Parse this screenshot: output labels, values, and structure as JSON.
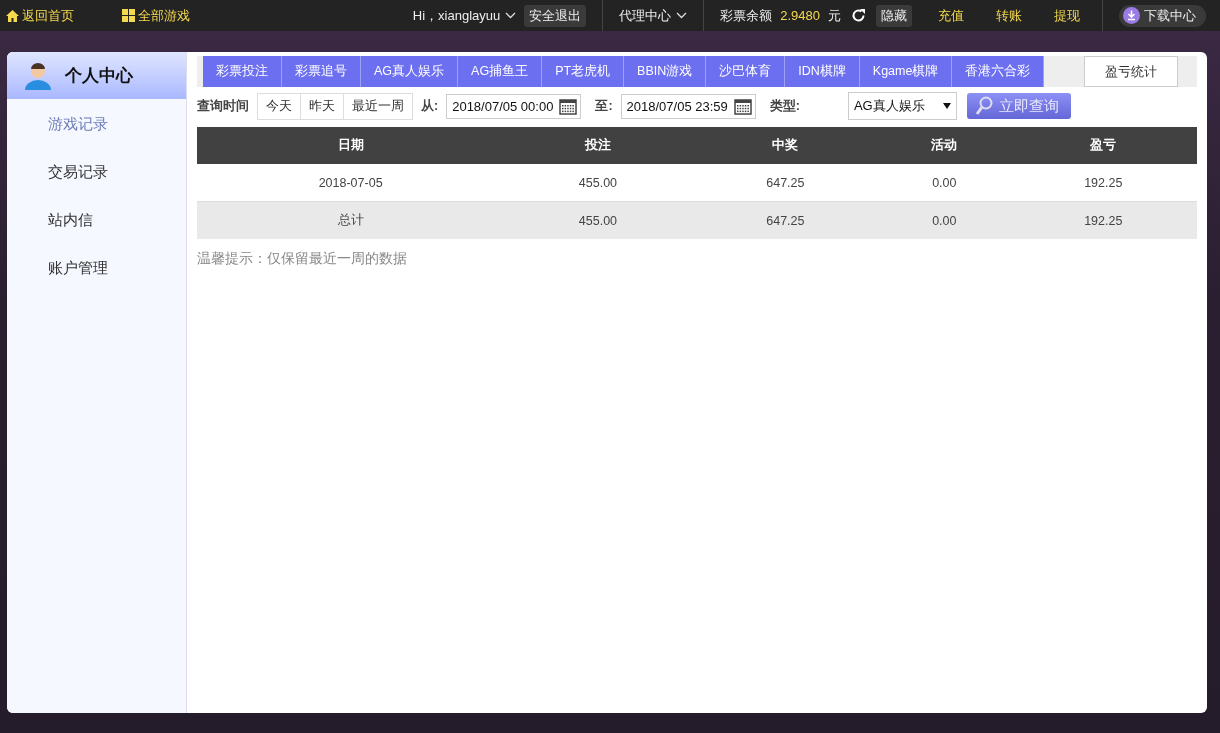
{
  "topbar": {
    "home": "返回首页",
    "all_games": "全部游戏",
    "greeting": "Hi，xianglayuu",
    "logout": "安全退出",
    "agent": "代理中心",
    "balance_label": "彩票余额",
    "balance": "2.9480",
    "currency": "元",
    "hide": "隐藏",
    "links": [
      "充值",
      "转账",
      "提现"
    ],
    "download": "下载中心"
  },
  "sidebar": {
    "title": "个人中心",
    "items": [
      {
        "label": "游戏记录",
        "selected": true
      },
      {
        "label": "交易记录",
        "selected": false
      },
      {
        "label": "站内信",
        "selected": false
      },
      {
        "label": "账户管理",
        "selected": false
      }
    ]
  },
  "tabs": [
    {
      "label": "彩票投注",
      "selected": false
    },
    {
      "label": "彩票追号",
      "selected": false
    },
    {
      "label": "AG真人娱乐",
      "selected": false
    },
    {
      "label": "AG捕鱼王",
      "selected": false
    },
    {
      "label": "PT老虎机",
      "selected": false
    },
    {
      "label": "BBIN游戏",
      "selected": false
    },
    {
      "label": "沙巴体育",
      "selected": false
    },
    {
      "label": "IDN棋牌",
      "selected": false
    },
    {
      "label": "Kgame棋牌",
      "selected": false
    },
    {
      "label": "香港六合彩",
      "selected": false
    },
    {
      "label": "盈亏统计",
      "selected": true
    }
  ],
  "filter": {
    "time_label": "查询时间",
    "quick": [
      "今天",
      "昨天",
      "最近一周"
    ],
    "from_label": "从:",
    "from": "2018/07/05 00:00",
    "to_label": "至:",
    "to": "2018/07/05 23:59",
    "type_label": "类型:",
    "type": "AG真人娱乐",
    "search": "立即查询"
  },
  "table": {
    "columns": [
      "日期",
      "投注",
      "中奖",
      "活动",
      "盈亏"
    ],
    "rows": [
      {
        "kind": "data",
        "cells": [
          "2018-07-05",
          "455.00",
          "647.25",
          "0.00",
          "192.25"
        ]
      },
      {
        "kind": "total",
        "cells": [
          "总计",
          "455.00",
          "647.25",
          "0.00",
          "192.25"
        ]
      }
    ]
  },
  "note": "温馨提示：仅保留最近一周的数据"
}
